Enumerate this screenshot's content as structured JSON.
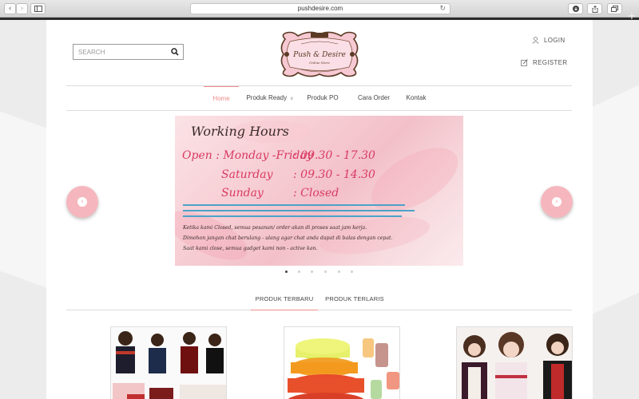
{
  "browser": {
    "url": "pushdesire.com",
    "back_icon": "chevron-left-icon",
    "forward_icon": "chevron-right-icon",
    "sidebar_icon": "sidebar-icon",
    "reload_icon": "reload-icon",
    "download_icon": "download-icon",
    "share_icon": "share-icon",
    "tabs_icon": "tabs-icon",
    "newtab_icon": "plus-icon"
  },
  "header": {
    "search_placeholder": "SEARCH",
    "logo_text": "Push & Desire",
    "logo_sub": "Online Store",
    "login_label": "LOGIN",
    "register_label": "REGISTER"
  },
  "nav": {
    "items": [
      {
        "label": "Home",
        "active": true
      },
      {
        "label": "Produk Ready",
        "has_dropdown": true
      },
      {
        "label": "Produk PO"
      },
      {
        "label": "Cara Order"
      },
      {
        "label": "Kontak"
      }
    ]
  },
  "slider": {
    "title": "Working Hours",
    "schedule": [
      {
        "label": "Open : Monday -Friday",
        "time": ": 09.30 - 17.30"
      },
      {
        "label": "Saturday",
        "time": ": 09.30 - 14.30"
      },
      {
        "label": "Sunday",
        "time": ": Closed"
      }
    ],
    "notes": [
      "Ketika kami Closed, semua pesanan/ order akan di proses saat jam kerja.",
      "Dimohon jangan chat berulang - ulang agar chat anda dapat di balas dengan cepat.",
      "Saat kami close, semua gadget kami non - active kan."
    ],
    "slide_count": 6,
    "active_slide": 1
  },
  "product_tabs": [
    {
      "label": "PRODUK TERBARU",
      "active": true
    },
    {
      "label": "PRODUK TERLARIS"
    }
  ],
  "colors": {
    "accent": "#f08c8c",
    "arrow_bg": "#f5b7bd",
    "slide_text": "#d93a62"
  }
}
